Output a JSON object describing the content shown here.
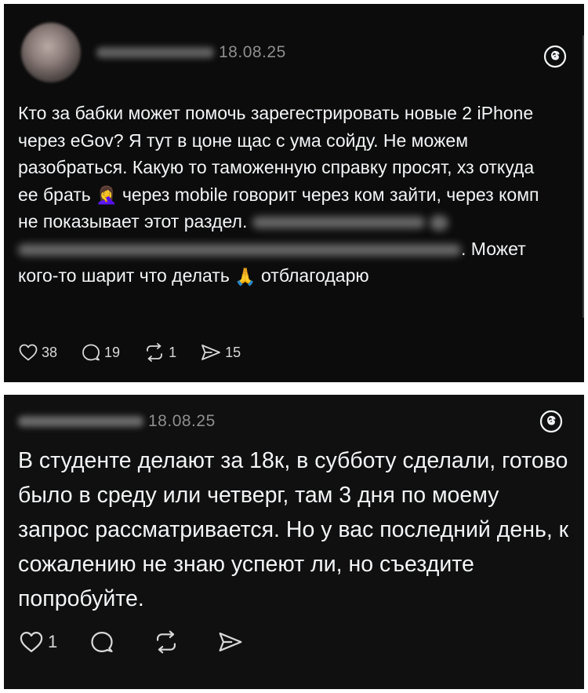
{
  "post1": {
    "time": "18.08.25",
    "text_a": "Кто за бабки может помочь зарегестрировать новые 2 iPhone через eGov? Я тут в цоне щас с ума сойду. Не можем разобраться. Какую то таможенную справку просят, хз откуда ее брать",
    "emoji_a": "🤦‍♀️",
    "text_b": " через mobile говорит через ком зайти, через комп не показывает этот раздел.",
    "text_c": ". Может кого-то шарит что делать",
    "emoji_b": "🙏",
    "text_d": " отблагодарю",
    "actions": {
      "likes": "38",
      "comments": "19",
      "reposts": "1",
      "shares": "15"
    }
  },
  "post2": {
    "time": "18.08.25",
    "text": "В студенте делают за 18к, в субботу сделали, готово было в среду или четверг, там 3 дня по моему запрос рассматривается. Но у вас последний день, к сожалению не знаю успеют ли, но съездите попробуйте.",
    "actions": {
      "likes": "1"
    }
  },
  "icons": {
    "threads": "threads-logo-icon",
    "like": "heart-icon",
    "comment": "comment-bubble-icon",
    "repost": "repost-icon",
    "share": "send-icon"
  },
  "colors": {
    "background": "#0c0c0c",
    "text": "#f3f5f7",
    "muted": "#8e8e8e"
  }
}
